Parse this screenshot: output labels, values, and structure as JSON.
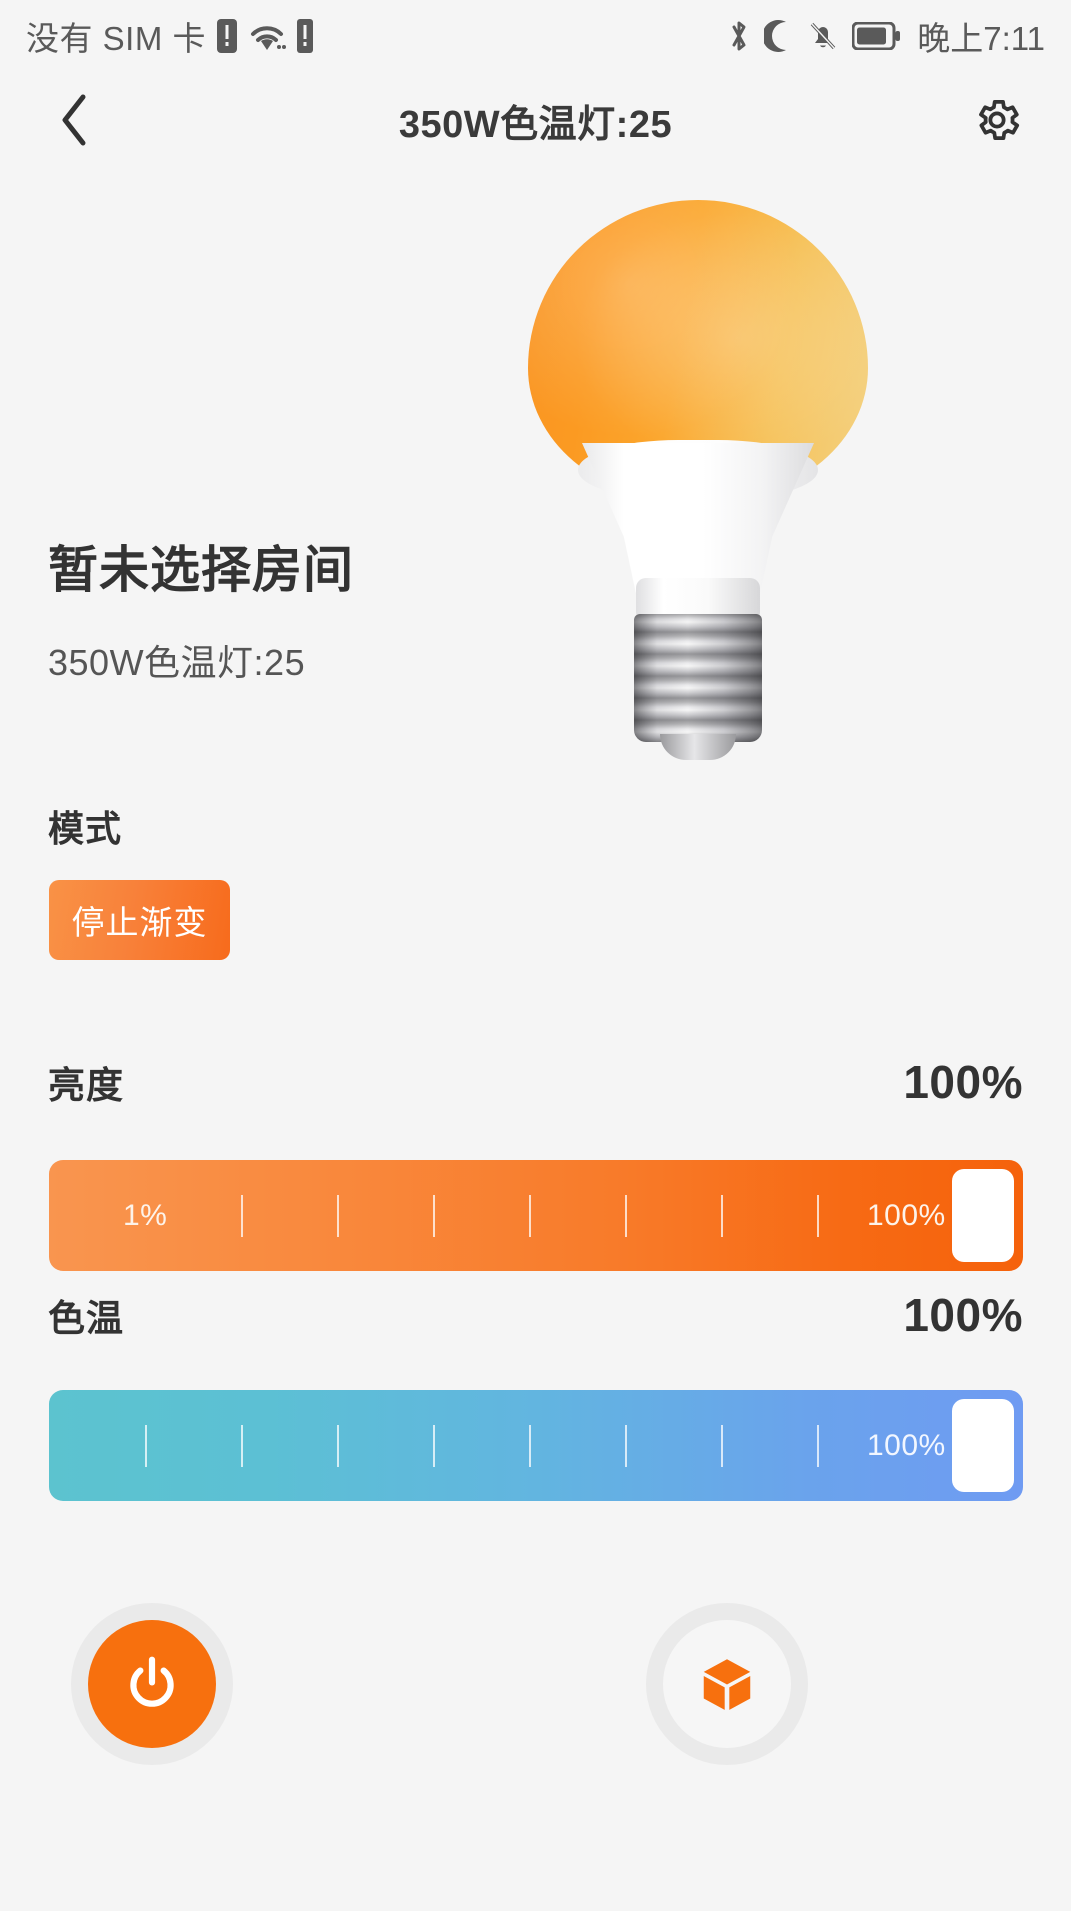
{
  "statusbar": {
    "carrier_text": "没有 SIM 卡",
    "time": "晚上7:11",
    "icons": {
      "sim_warning": "sim-warning-icon",
      "wifi": "wifi-icon",
      "signal_warning": "signal-warning-icon",
      "bluetooth": "bluetooth-icon",
      "do_not_disturb": "moon-icon",
      "mute": "bell-muted-icon",
      "battery": "battery-icon"
    }
  },
  "appbar": {
    "title": "350W色温灯:25",
    "back_icon": "chevron-left-icon",
    "settings_icon": "gear-icon"
  },
  "device": {
    "room_title": "暂未选择房间",
    "name": "350W色温灯:25",
    "bulb_image": "light-bulb-illustration"
  },
  "mode": {
    "label": "模式",
    "button_label": "停止渐变"
  },
  "brightness": {
    "label": "亮度",
    "value_text": "100%",
    "value": 100,
    "min_label": "1%",
    "max_label": "100%",
    "tick_count": 8,
    "gradient_start": "#f9954f",
    "gradient_end": "#f5620b"
  },
  "color_temp": {
    "label": "色温",
    "value_text": "100%",
    "value": 100,
    "min_label": "",
    "max_label": "100%",
    "tick_count": 8,
    "gradient_start": "#5cc3cf",
    "gradient_end": "#6f9bf2"
  },
  "actions": {
    "power_icon": "power-icon",
    "scene_icon": "cube-icon",
    "power_color": "#f7700e",
    "scene_icon_color": "#f7700e"
  }
}
